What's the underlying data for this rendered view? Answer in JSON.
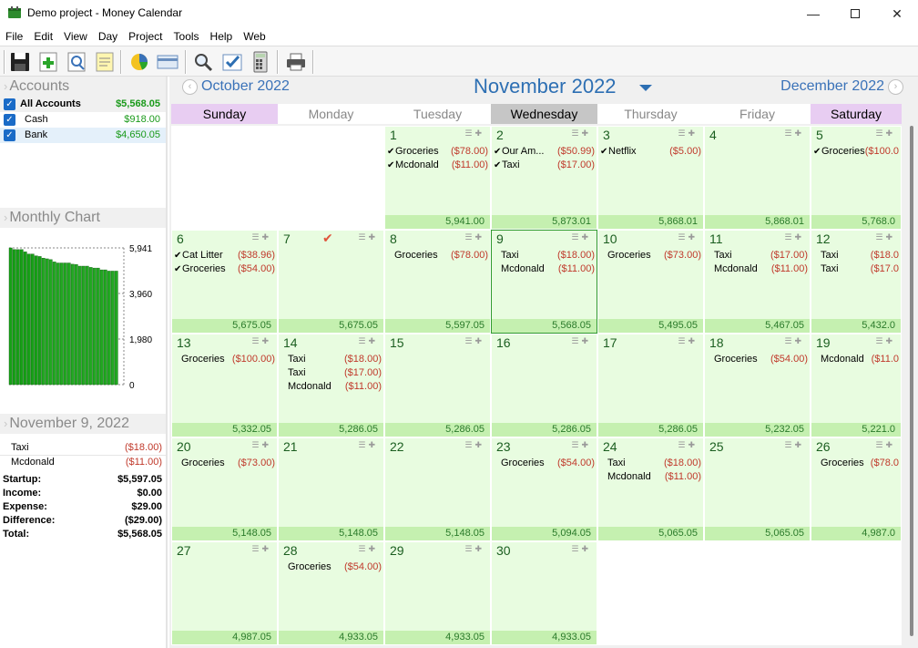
{
  "window": {
    "title": "Demo project - Money Calendar"
  },
  "menu": [
    "File",
    "Edit",
    "View",
    "Day",
    "Project",
    "Tools",
    "Help",
    "Web"
  ],
  "toolbar": [
    "save-icon",
    "add-icon",
    "preview-icon",
    "notes-icon",
    "pie-chart-icon",
    "card-icon",
    "search-icon",
    "checklist-icon",
    "calculator-icon",
    "print-icon"
  ],
  "accounts": {
    "title": "Accounts",
    "items": [
      {
        "name": "All Accounts",
        "value": "$5,568.05"
      },
      {
        "name": "Cash",
        "value": "$918.00"
      },
      {
        "name": "Bank",
        "value": "$4,650.05"
      }
    ]
  },
  "monthly_chart": {
    "title": "Monthly Chart",
    "ticks": [
      "5,941",
      "3,960",
      "1,980",
      "0"
    ]
  },
  "chart_data": {
    "type": "bar",
    "title": "Monthly Chart",
    "values": [
      5941,
      5873,
      5868,
      5868,
      5768,
      5675,
      5675,
      5597,
      5568,
      5495,
      5467,
      5432,
      5332,
      5286,
      5286,
      5286,
      5286,
      5232,
      5221,
      5148,
      5148,
      5148,
      5094,
      5065,
      5065,
      4987,
      4987,
      4933,
      4933,
      4933
    ],
    "ylim": [
      0,
      5941
    ],
    "yticks": [
      0,
      1980,
      3960,
      5941
    ],
    "grid": true,
    "color": "#1fa81f"
  },
  "day_detail": {
    "title": "November 9, 2022",
    "items": [
      {
        "name": "Taxi",
        "amount": "($18.00)"
      },
      {
        "name": "Mcdonald",
        "amount": "($11.00)"
      }
    ],
    "summary": [
      {
        "label": "Startup:",
        "value": "$5,597.05"
      },
      {
        "label": "Income:",
        "value": "$0.00"
      },
      {
        "label": "Expense:",
        "value": "$29.00"
      },
      {
        "label": "Difference:",
        "value": "($29.00)"
      },
      {
        "label": "Total:",
        "value": "$5,568.05"
      }
    ]
  },
  "calendar": {
    "prev_month": "October 2022",
    "current_month": "November 2022",
    "next_month": "December 2022",
    "weekdays": [
      "Sunday",
      "Monday",
      "Tuesday",
      "Wednesday",
      "Thursday",
      "Friday",
      "Saturday"
    ],
    "weeks": [
      [
        null,
        null,
        {
          "day": "1",
          "balance": "5,941.00",
          "tx": [
            {
              "name": "Groceries",
              "amount": "($78.00)",
              "checked": true
            },
            {
              "name": "Mcdonald",
              "amount": "($11.00)",
              "checked": true
            }
          ]
        },
        {
          "day": "2",
          "balance": "5,873.01",
          "tx": [
            {
              "name": "Our Am...",
              "amount": "($50.99)",
              "checked": true
            },
            {
              "name": "Taxi",
              "amount": "($17.00)",
              "checked": true
            }
          ]
        },
        {
          "day": "3",
          "balance": "5,868.01",
          "tx": [
            {
              "name": "Netflix",
              "amount": "($5.00)",
              "checked": true
            }
          ]
        },
        {
          "day": "4",
          "balance": "5,868.01",
          "tx": []
        },
        {
          "day": "5",
          "balance": "5,768.0",
          "tx": [
            {
              "name": "Groceries",
              "amount": "($100.0",
              "checked": true
            }
          ]
        }
      ],
      [
        {
          "day": "6",
          "balance": "5,675.05",
          "tx": [
            {
              "name": "Cat Litter",
              "amount": "($38.96)",
              "checked": true
            },
            {
              "name": "Groceries",
              "amount": "($54.00)",
              "checked": true
            }
          ]
        },
        {
          "day": "7",
          "balance": "5,675.05",
          "tx": [],
          "marked": true
        },
        {
          "day": "8",
          "balance": "5,597.05",
          "tx": [
            {
              "name": "Groceries",
              "amount": "($78.00)"
            }
          ]
        },
        {
          "day": "9",
          "balance": "5,568.05",
          "tx": [
            {
              "name": "Taxi",
              "amount": "($18.00)"
            },
            {
              "name": "Mcdonald",
              "amount": "($11.00)"
            }
          ],
          "selected": true
        },
        {
          "day": "10",
          "balance": "5,495.05",
          "tx": [
            {
              "name": "Groceries",
              "amount": "($73.00)"
            }
          ]
        },
        {
          "day": "11",
          "balance": "5,467.05",
          "tx": [
            {
              "name": "Taxi",
              "amount": "($17.00)"
            },
            {
              "name": "Mcdonald",
              "amount": "($11.00)"
            }
          ]
        },
        {
          "day": "12",
          "balance": "5,432.0",
          "tx": [
            {
              "name": "Taxi",
              "amount": "($18.0"
            },
            {
              "name": "Taxi",
              "amount": "($17.0"
            }
          ]
        }
      ],
      [
        {
          "day": "13",
          "balance": "5,332.05",
          "tx": [
            {
              "name": "Groceries",
              "amount": "($100.00)"
            }
          ]
        },
        {
          "day": "14",
          "balance": "5,286.05",
          "tx": [
            {
              "name": "Taxi",
              "amount": "($18.00)"
            },
            {
              "name": "Taxi",
              "amount": "($17.00)"
            },
            {
              "name": "Mcdonald",
              "amount": "($11.00)"
            }
          ]
        },
        {
          "day": "15",
          "balance": "5,286.05",
          "tx": []
        },
        {
          "day": "16",
          "balance": "5,286.05",
          "tx": []
        },
        {
          "day": "17",
          "balance": "5,286.05",
          "tx": []
        },
        {
          "day": "18",
          "balance": "5,232.05",
          "tx": [
            {
              "name": "Groceries",
              "amount": "($54.00)"
            }
          ]
        },
        {
          "day": "19",
          "balance": "5,221.0",
          "tx": [
            {
              "name": "Mcdonald",
              "amount": "($11.0"
            }
          ]
        }
      ],
      [
        {
          "day": "20",
          "balance": "5,148.05",
          "tx": [
            {
              "name": "Groceries",
              "amount": "($73.00)"
            }
          ]
        },
        {
          "day": "21",
          "balance": "5,148.05",
          "tx": []
        },
        {
          "day": "22",
          "balance": "5,148.05",
          "tx": []
        },
        {
          "day": "23",
          "balance": "5,094.05",
          "tx": [
            {
              "name": "Groceries",
              "amount": "($54.00)"
            }
          ]
        },
        {
          "day": "24",
          "balance": "5,065.05",
          "tx": [
            {
              "name": "Taxi",
              "amount": "($18.00)"
            },
            {
              "name": "Mcdonald",
              "amount": "($11.00)"
            }
          ]
        },
        {
          "day": "25",
          "balance": "5,065.05",
          "tx": []
        },
        {
          "day": "26",
          "balance": "4,987.0",
          "tx": [
            {
              "name": "Groceries",
              "amount": "($78.0"
            }
          ]
        }
      ],
      [
        {
          "day": "27",
          "balance": "4,987.05",
          "tx": []
        },
        {
          "day": "28",
          "balance": "4,933.05",
          "tx": [
            {
              "name": "Groceries",
              "amount": "($54.00)"
            }
          ]
        },
        {
          "day": "29",
          "balance": "4,933.05",
          "tx": []
        },
        {
          "day": "30",
          "balance": "4,933.05",
          "tx": []
        },
        null,
        null,
        null
      ]
    ]
  }
}
